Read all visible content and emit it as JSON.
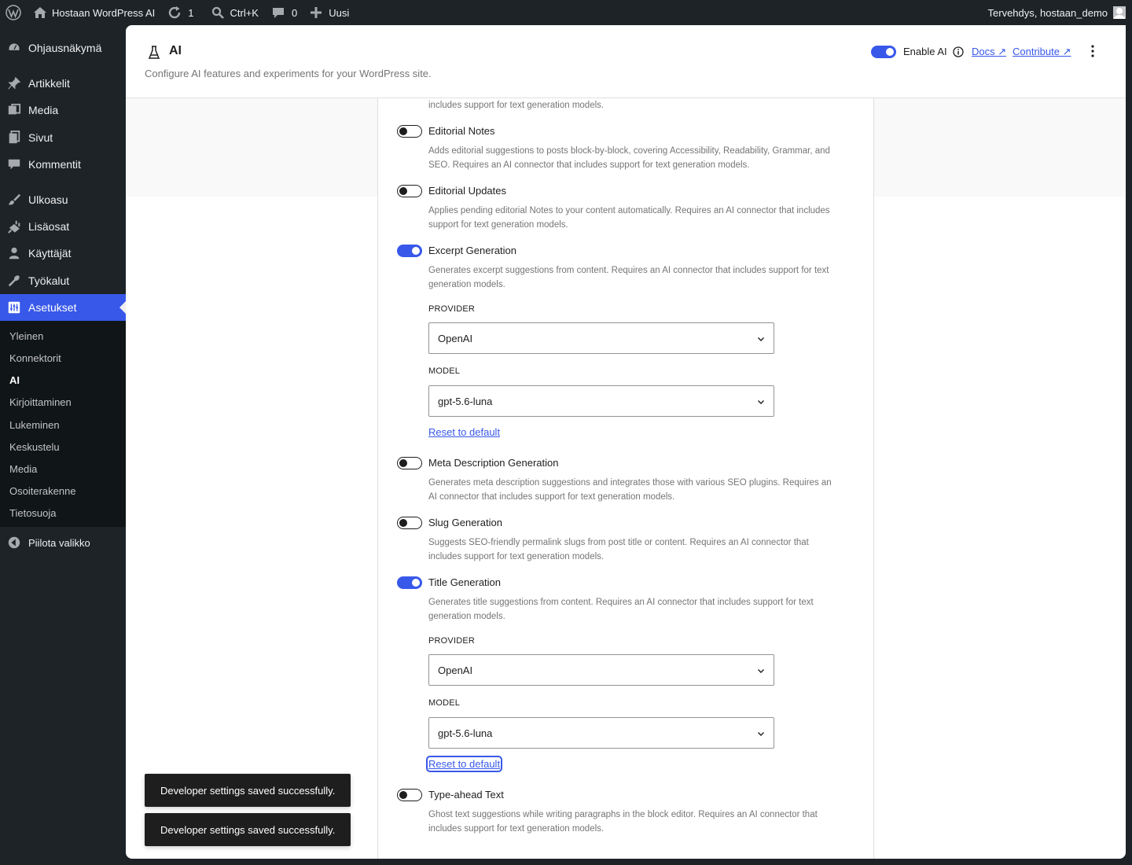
{
  "adminbar": {
    "site_name": "Hostaan WordPress AI",
    "updates_count": "1",
    "search_shortcut": "Ctrl+K",
    "comments_count": "0",
    "new_label": "Uusi",
    "greeting": "Tervehdys, hostaan_demo"
  },
  "sidebar": {
    "items": [
      {
        "label": "Ohjausnäkymä",
        "icon": "dashboard-icon"
      },
      {
        "label": "Artikkelit",
        "icon": "pin-icon"
      },
      {
        "label": "Media",
        "icon": "media-icon"
      },
      {
        "label": "Sivut",
        "icon": "pages-icon"
      },
      {
        "label": "Kommentit",
        "icon": "comments-icon"
      },
      {
        "label": "Ulkoasu",
        "icon": "brush-icon"
      },
      {
        "label": "Lisäosat",
        "icon": "plugin-icon"
      },
      {
        "label": "Käyttäjät",
        "icon": "users-icon"
      },
      {
        "label": "Työkalut",
        "icon": "wrench-icon"
      },
      {
        "label": "Asetukset",
        "icon": "settings-icon"
      }
    ],
    "submenu": [
      "Yleinen",
      "Konnektorit",
      "AI",
      "Kirjoittaminen",
      "Lukeminen",
      "Keskustelu",
      "Media",
      "Osoiterakenne",
      "Tietosuoja"
    ],
    "collapse_label": "Piilota valikko"
  },
  "page": {
    "title": "AI",
    "subtitle": "Configure AI features and experiments for your WordPress site.",
    "enable_label": "Enable AI",
    "docs_label": "Docs ↗",
    "contribute_label": "Contribute ↗"
  },
  "features": {
    "cut_desc": "includes support for text generation models.",
    "editorial_notes": {
      "label": "Editorial Notes",
      "enabled": false,
      "desc1": "Adds editorial suggestions to posts block-by-block, covering Accessibility, Readability, Grammar, and",
      "desc2": "SEO. Requires an AI connector that includes support for text generation models."
    },
    "editorial_updates": {
      "label": "Editorial Updates",
      "enabled": false,
      "desc1": "Applies pending editorial Notes to your content automatically. Requires an AI connector that includes",
      "desc2": "support for text generation models."
    },
    "excerpt": {
      "label": "Excerpt Generation",
      "enabled": true,
      "desc1": "Generates excerpt suggestions from content. Requires an AI connector that includes support for text",
      "desc2": "generation models.",
      "provider_label": "PROVIDER",
      "provider": "OpenAI",
      "model_label": "MODEL",
      "model": "gpt-5.6-luna",
      "reset": "Reset to default"
    },
    "meta": {
      "label": "Meta Description Generation",
      "enabled": false,
      "desc1": "Generates meta description suggestions and integrates those with various SEO plugins. Requires an",
      "desc2": "AI connector that includes support for text generation models."
    },
    "slug": {
      "label": "Slug Generation",
      "enabled": false,
      "desc1": "Suggests SEO-friendly permalink slugs from post title or content. Requires an AI connector that",
      "desc2": "includes support for text generation models."
    },
    "title": {
      "label": "Title Generation",
      "enabled": true,
      "desc1": "Generates title suggestions from content. Requires an AI connector that includes support for text",
      "desc2": "generation models.",
      "provider_label": "PROVIDER",
      "provider": "OpenAI",
      "model_label": "MODEL",
      "model": "gpt-5.6-luna",
      "reset": "Reset to default"
    },
    "typeahead": {
      "label": "Type-ahead Text",
      "enabled": false,
      "desc1": "Ghost text suggestions while writing paragraphs in the block editor. Requires an AI connector that",
      "desc2": "includes support for text generation models."
    }
  },
  "notices": [
    "Developer settings saved successfully.",
    "Developer settings saved successfully."
  ],
  "colors": {
    "accent": "#3858e9",
    "admin_bg": "#1d2327"
  }
}
